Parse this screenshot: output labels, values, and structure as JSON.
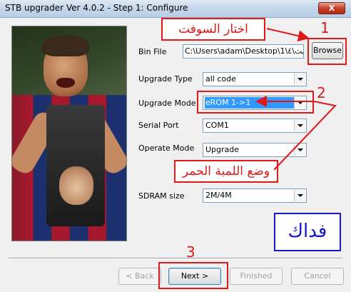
{
  "window": {
    "title": "STB upgrader Ver 4.0.2 - Step 1: Configure",
    "close_label": "X"
  },
  "form": {
    "bin_file": {
      "label": "Bin File",
      "value": "C:\\Users\\adam\\Desktop\\حديث\\٤\\1",
      "browse_label": "Browse"
    },
    "upgrade_type": {
      "label": "Upgrade Type",
      "value": "all code"
    },
    "upgrade_mode": {
      "label": "Upgrade Mode",
      "value": "eROM  1->1"
    },
    "serial_port": {
      "label": "Serial Port",
      "value": "COM1"
    },
    "operate_mode": {
      "label": "Operate Mode",
      "value": "Upgrade"
    },
    "sdram_size": {
      "label": "SDRAM size",
      "value": "2M/4M"
    }
  },
  "buttons": {
    "back": "< Back",
    "next": "Next >",
    "finished": "Finished",
    "cancel": "Cancel"
  },
  "annotations": {
    "step1_number": "1",
    "step1_text": "اختار السوفت",
    "step2_number": "2",
    "step2_text": "وضع اللمبة الحمر",
    "step3_number": "3",
    "signature": "فداك"
  },
  "colors": {
    "annotation_red": "#e01818",
    "annotation_blue": "#1418c8",
    "selection_blue": "#3399ff"
  }
}
